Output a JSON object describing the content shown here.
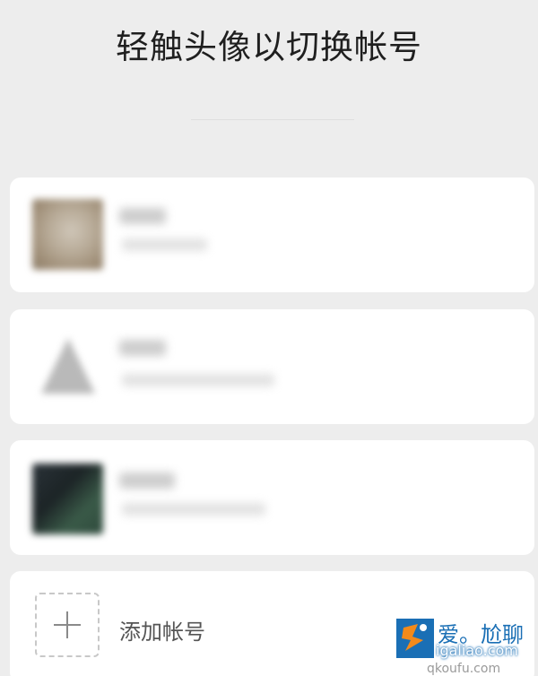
{
  "header": {
    "title": "轻触头像以切换帐号"
  },
  "accounts": [
    {
      "avatar_icon": "avatar-photo-beige"
    },
    {
      "avatar_icon": "avatar-triangle-gray"
    },
    {
      "avatar_icon": "avatar-photo-dark-green"
    }
  ],
  "add_account": {
    "label": "添加帐号",
    "icon": "plus-icon"
  },
  "watermark": {
    "title": "爱。尬聊",
    "url": "igaliao.com",
    "url_secondary": "qkoufu.com"
  },
  "colors": {
    "background": "#ededed",
    "card": "#ffffff",
    "watermark_blue": "#1a6fb5",
    "watermark_orange": "#f28a1b"
  }
}
